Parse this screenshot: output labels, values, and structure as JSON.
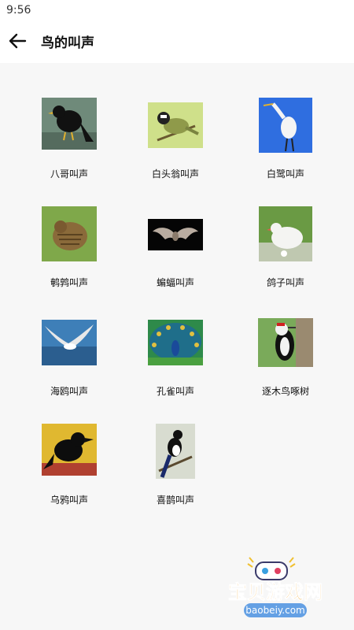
{
  "status_bar": {
    "time": "9:56"
  },
  "app_bar": {
    "title": "鸟的叫声",
    "back_icon": "arrow-left-icon"
  },
  "birds": [
    {
      "label": "八哥叫声"
    },
    {
      "label": "白头翁叫声"
    },
    {
      "label": "白鹭叫声"
    },
    {
      "label": "鹌鹑叫声"
    },
    {
      "label": "蝙蝠叫声"
    },
    {
      "label": "鸽子叫声"
    },
    {
      "label": "海鸥叫声"
    },
    {
      "label": "孔雀叫声"
    },
    {
      "label": "逐木鸟啄树"
    },
    {
      "label": "乌鸦叫声"
    },
    {
      "label": "喜鹊叫声"
    }
  ],
  "watermark": {
    "title": "宝贝游戏网",
    "url": "baobeiy.com"
  }
}
